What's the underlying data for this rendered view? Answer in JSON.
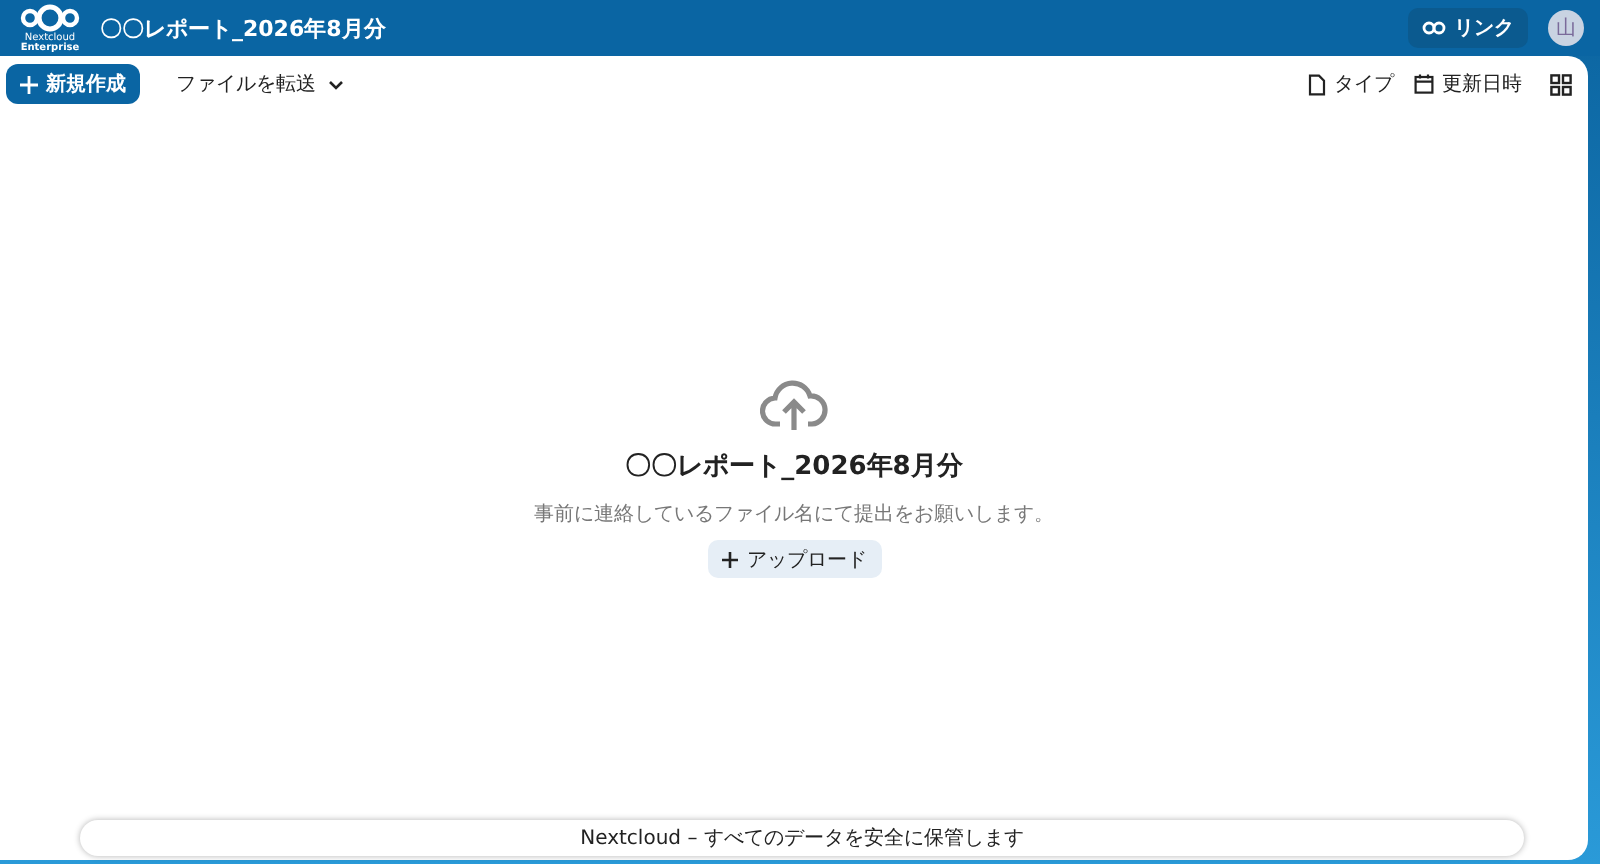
{
  "header": {
    "logo_text": "Nextcloud",
    "logo_subtext": "Enterprise",
    "title": "〇〇レポート_2026年8月分",
    "link_button": "リンク",
    "avatar": "山"
  },
  "toolbar": {
    "new_button": "新規作成",
    "transfer_menu": "ファイルを転送",
    "sort_type": "タイプ",
    "sort_modified": "更新日時"
  },
  "empty": {
    "title": "〇〇レポート_2026年8月分",
    "description": "事前に連絡しているファイル名にて提出をお願いします。",
    "upload_button": "アップロード"
  },
  "footer": {
    "brand": "Nextcloud",
    "text": " – すべてのデータを安全に保管します"
  }
}
